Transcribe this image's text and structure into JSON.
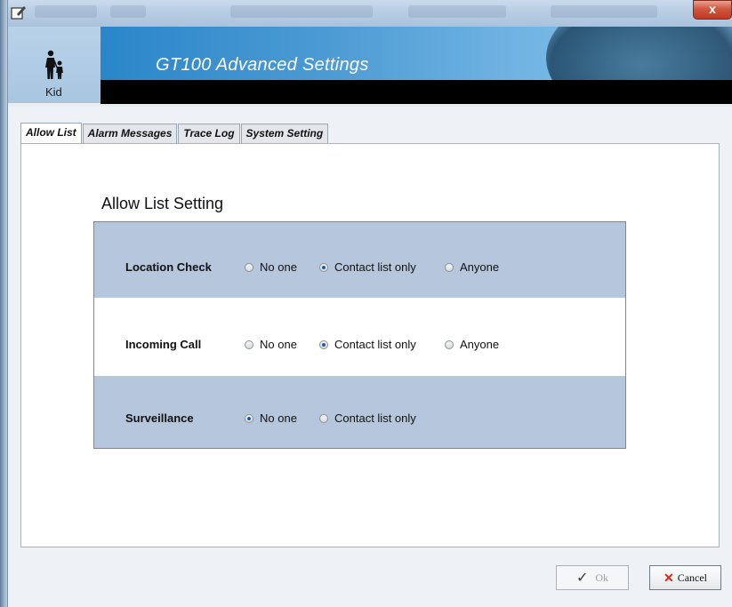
{
  "window": {
    "close_label": "x"
  },
  "banner": {
    "title": "GT100 Advanced Settings",
    "profile_label": "Kid"
  },
  "tabs": [
    {
      "label": "Allow List",
      "active": true
    },
    {
      "label": "Alarm Messages",
      "active": false
    },
    {
      "label": "Trace Log",
      "active": false
    },
    {
      "label": "System Setting",
      "active": false
    }
  ],
  "allow_list": {
    "heading": "Allow List Setting",
    "rows": [
      {
        "label": "Location Check",
        "options": [
          "No one",
          "Contact list only",
          "Anyone"
        ],
        "selected": "Contact list only"
      },
      {
        "label": "Incoming Call",
        "options": [
          "No one",
          "Contact list only",
          "Anyone"
        ],
        "selected": "Contact list only"
      },
      {
        "label": "Surveillance",
        "options": [
          "No one",
          "Contact list only"
        ],
        "selected": "No one"
      }
    ]
  },
  "footer": {
    "ok_label": "Ok",
    "cancel_label": "Cancel"
  },
  "colors": {
    "row_shaded": "#b5c6dd",
    "banner_blue": "#2a86c9",
    "radio_selected": "#1d5aa6",
    "cancel_x": "#d8261d"
  }
}
